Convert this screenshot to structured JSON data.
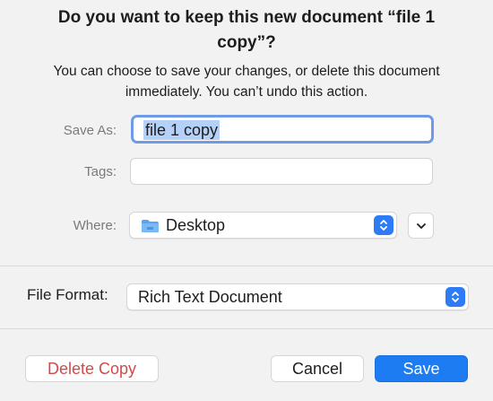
{
  "dialog": {
    "title": "Do you want to keep this new document “file 1 copy”?",
    "message": "You can choose to save your changes, or delete this document immediately. You can’t undo this action."
  },
  "form": {
    "save_as_label": "Save As:",
    "save_as_value": "file 1 copy",
    "tags_label": "Tags:",
    "tags_value": "",
    "where_label": "Where:",
    "where_value": "Desktop",
    "file_format_label": "File Format:",
    "file_format_value": "Rich Text Document"
  },
  "buttons": {
    "delete_label": "Delete Copy",
    "cancel_label": "Cancel",
    "save_label": "Save"
  },
  "colors": {
    "accent": "#1e7cf2",
    "destructive": "#d24a4a",
    "selection": "#b5d1f7",
    "folder": "#5aa3f0"
  },
  "icons": {
    "where_folder": "folder-icon",
    "where_stepper": "chevron-updown-icon",
    "expand": "chevron-down-icon",
    "format_stepper": "chevron-updown-icon"
  }
}
